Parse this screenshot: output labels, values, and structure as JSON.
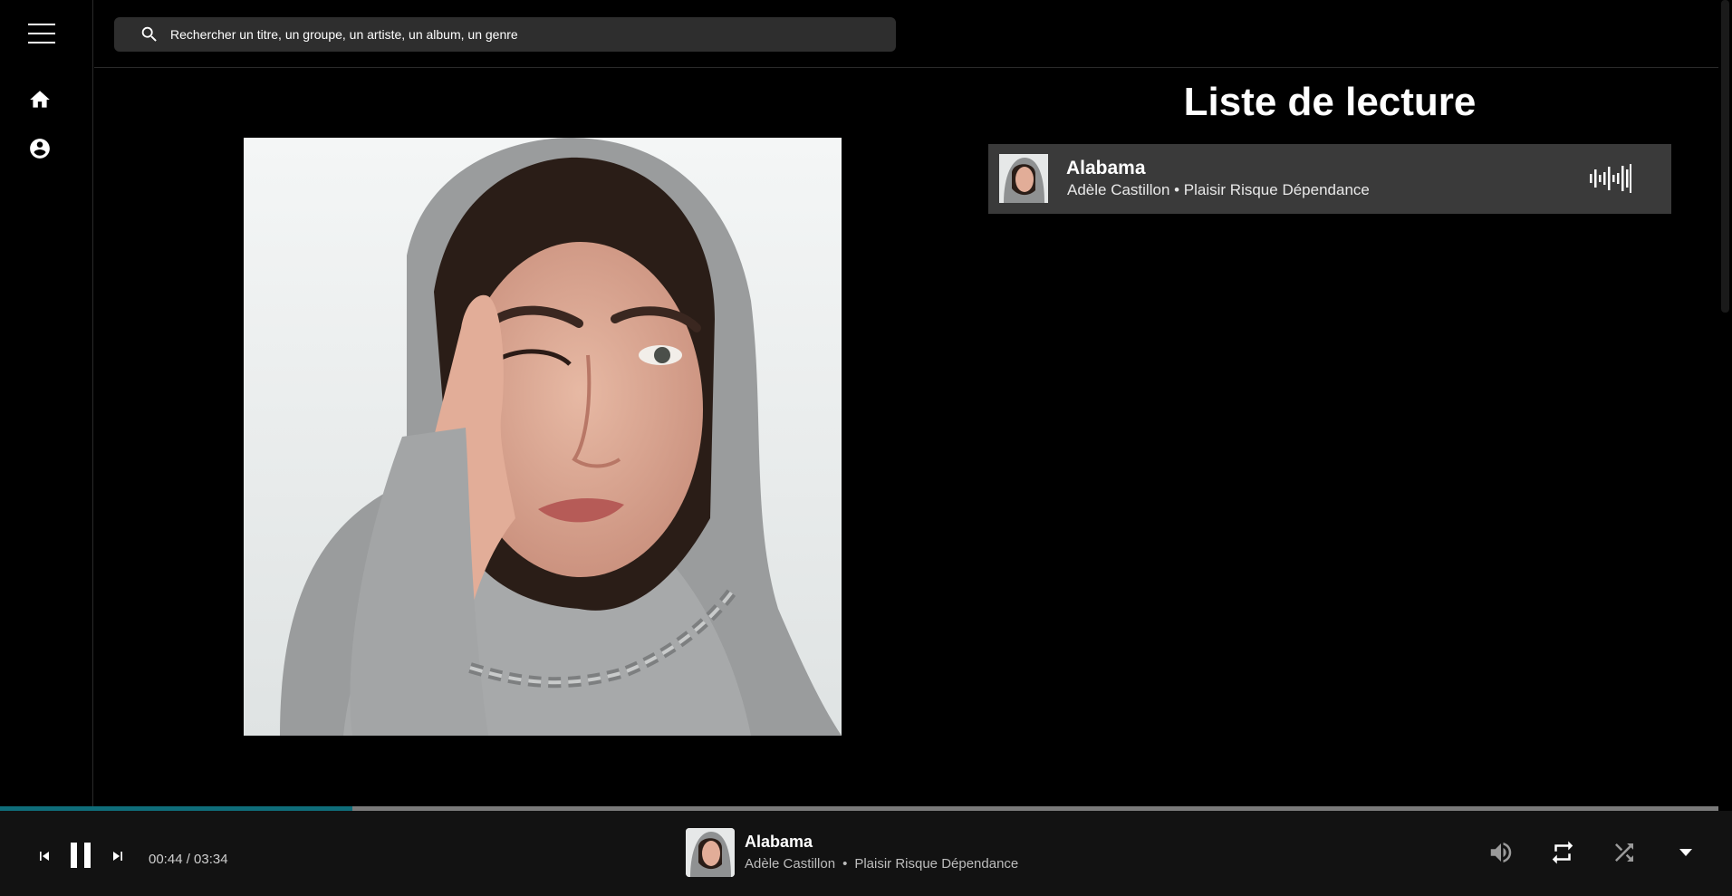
{
  "search": {
    "placeholder": "Rechercher un titre, un groupe, un artiste, un album, un genre"
  },
  "sidebar": {
    "items": [
      {
        "icon": "home-icon"
      },
      {
        "icon": "account-icon"
      }
    ]
  },
  "playlist": {
    "title": "Liste de lecture",
    "tracks": [
      {
        "title": "Alabama",
        "artist": "Adèle Castillon",
        "album": "Plaisir Risque Dépendance",
        "subtitle": "Adèle Castillon • Plaisir Risque Dépendance",
        "playing": true
      }
    ]
  },
  "player": {
    "elapsed": "00:44",
    "duration": "03:34",
    "time_text": "00:44 / 03:34",
    "progress_fraction": 0.205,
    "track": {
      "title": "Alabama",
      "artist": "Adèle Castillon",
      "separator": "•",
      "album": "Plaisir Risque Dépendance"
    }
  },
  "colors": {
    "accent": "#0f6d7a",
    "row_bg": "#3a3a3a",
    "player_bg": "#121212"
  }
}
